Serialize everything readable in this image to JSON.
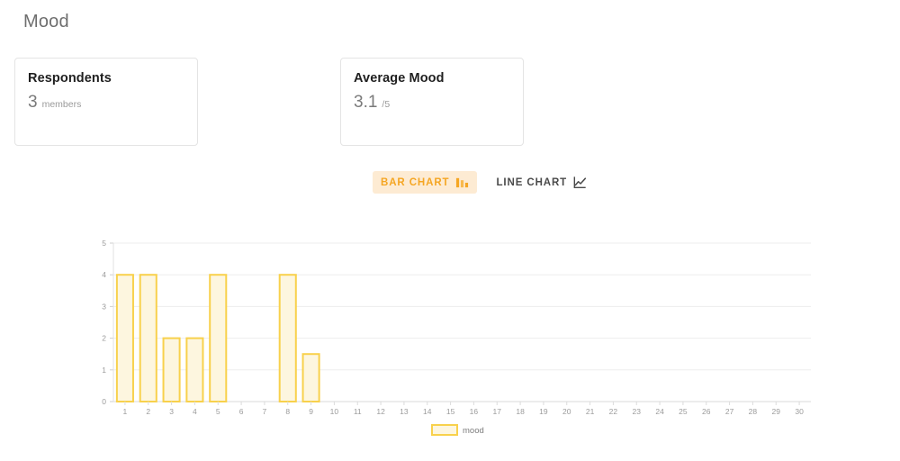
{
  "page": {
    "title": "Mood"
  },
  "cards": [
    {
      "title": "Respondents",
      "value": "3",
      "unit": "members",
      "name": "respondents"
    },
    {
      "title": "Average Mood",
      "value": "3.1",
      "unit": "/5",
      "name": "average-mood"
    }
  ],
  "chart_toggle": {
    "options": [
      {
        "label": "BAR CHART",
        "icon": "bar-chart-icon",
        "active": true
      },
      {
        "label": "LINE CHART",
        "icon": "line-chart-icon",
        "active": false
      }
    ]
  },
  "colors": {
    "accent": "#f5a623",
    "accent_bg": "#fdebd3",
    "bar_border": "#f8d14c",
    "bar_fill": "#fdf6df",
    "gridline": "#ededed",
    "axis_text": "#9b9b9b"
  },
  "chart_data": {
    "type": "bar",
    "title": "",
    "xlabel": "",
    "ylabel": "",
    "categories": [
      "1",
      "2",
      "3",
      "4",
      "5",
      "6",
      "7",
      "8",
      "9",
      "10",
      "11",
      "12",
      "13",
      "14",
      "15",
      "16",
      "17",
      "18",
      "19",
      "20",
      "21",
      "22",
      "23",
      "24",
      "25",
      "26",
      "27",
      "28",
      "29",
      "30"
    ],
    "series": [
      {
        "name": "mood",
        "values": [
          4,
          4,
          2,
          2,
          4,
          0,
          0,
          4,
          1.5,
          0,
          0,
          0,
          0,
          0,
          0,
          0,
          0,
          0,
          0,
          0,
          0,
          0,
          0,
          0,
          0,
          0,
          0,
          0,
          0,
          0
        ]
      }
    ],
    "ylim": [
      0,
      5
    ],
    "yticks": [
      "0",
      "1",
      "2",
      "3",
      "4",
      "5"
    ],
    "grid": true,
    "legend": {
      "position": "bottom",
      "entries": [
        "mood"
      ]
    }
  }
}
